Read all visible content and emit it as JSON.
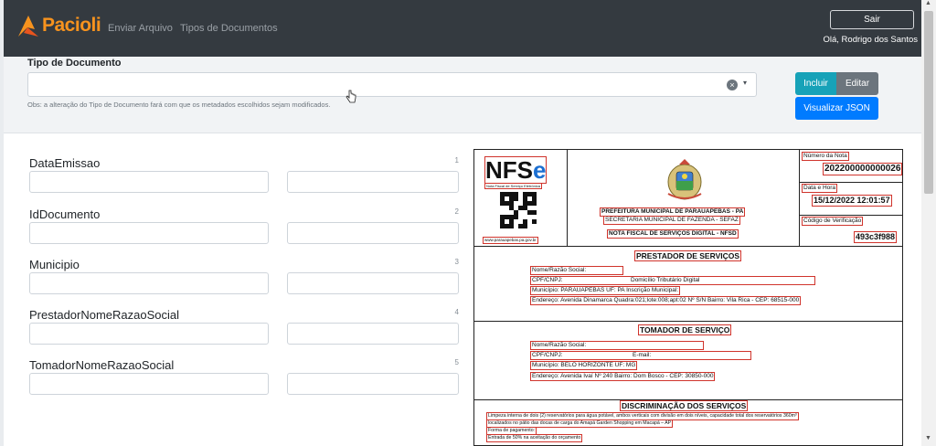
{
  "navbar": {
    "brand": "Pacioli",
    "links": [
      "Enviar Arquivo",
      "Tipos de Documentos"
    ],
    "logout_label": "Sair",
    "greeting": "Olá, Rodrigo dos Santos"
  },
  "doctype": {
    "label": "Tipo de Documento",
    "clear_glyph": "×",
    "caret_glyph": "▾",
    "note": "Obs: a alteração do Tipo de Documento fará com que os metadados escolhidos sejam modificados.",
    "add_label": "Incluir",
    "edit_label": "Editar",
    "json_label": "Visualizar JSON"
  },
  "fields": [
    {
      "label": "DataEmissao",
      "index": "1"
    },
    {
      "label": "IdDocumento",
      "index": "2"
    },
    {
      "label": "Municipio",
      "index": "3"
    },
    {
      "label": "PrestadorNomeRazaoSocial",
      "index": "4"
    },
    {
      "label": "TomadorNomeRazaoSocial",
      "index": "5"
    }
  ],
  "document": {
    "logo_text": "NFS",
    "logo_e": "e",
    "logo_sub": "Nota Fiscal de Serviço Eletrônica",
    "qr_caption": "www.parauapebas.pa.gov.br",
    "prefeitura": "PREFEITURA MUNICIPAL DE PARAUAPEBAS - PA",
    "secretaria": "SECRETARIA MUNICIPAL DE FAZENDA - SEFAZ",
    "nota_title": "NOTA FISCAL DE SERVIÇOS DIGITAL - NFSD",
    "numero_label": "Número da Nota",
    "numero_value": "202200000000026",
    "data_label": "Data e Hora",
    "data_value": "15/12/2022 12:01:57",
    "codigo_label": "Código de Verificação",
    "codigo_value": "493c3f988",
    "prestador_title": "PRESTADOR DE SERVIÇOS",
    "prestador_nome": "Nome/Razão Social:",
    "prestador_cpf": "CPF/CNPJ:",
    "prestador_domicilio": "Domicílio Tributário Digital",
    "prestador_municipio": "Município: PARAUAPEBAS UF: PA Inscrição Municipal:",
    "prestador_endereco": "Endereço: Avenida Dinamarca Quadra:021;lote:008;apt:02 Nº S/N Bairro: Vila Rica - CEP: 68515-000",
    "tomador_title": "TOMADOR DE SERVIÇO",
    "tomador_nome": "Nome/Razão Social:",
    "tomador_cpf": "CPF/CNPJ:",
    "tomador_email": "E-mail:",
    "tomador_municipio": "Município: BELO HORIZONTE UF: MG",
    "tomador_endereco": "Endereço: Avenida Ivaí Nº 240 Bairro: Dom Bosco - CEP: 30850-000",
    "discriminacao_title": "DISCRIMINAÇÃO DOS SERVIÇOS",
    "disc_line1": "Limpeza interna de dois (2) reservatórios para água potável, ambos verticais com divisão em dois níveis, capacidade total dos reservatórios 360m³",
    "disc_line2": "localizados no pátio das docas de carga do Amapá Garden Shopping em Macapá – AP",
    "disc_line3": "Forma de pagamento:",
    "disc_line4": "Entrada de 50% na aceitação do orçamento"
  }
}
